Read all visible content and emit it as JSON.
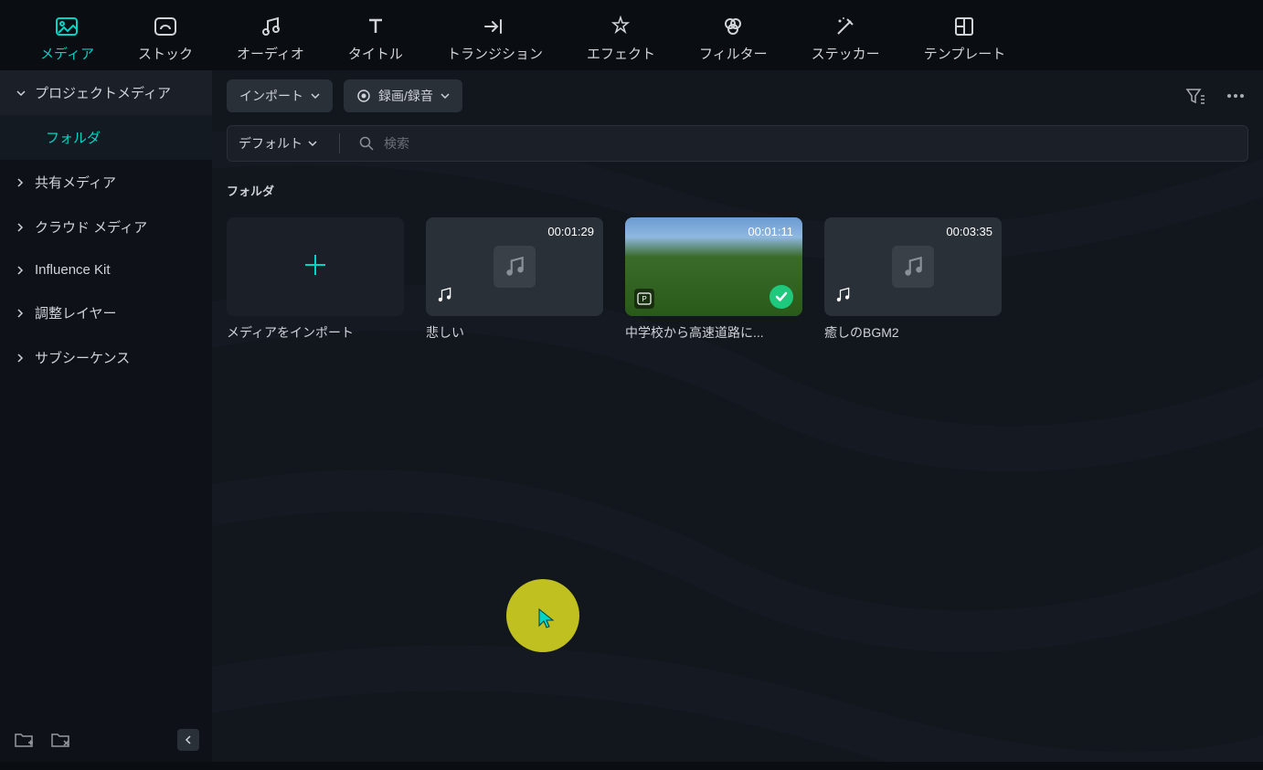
{
  "top_tabs": {
    "media": "メディア",
    "stock": "ストック",
    "audio": "オーディオ",
    "title": "タイトル",
    "transition": "トランジション",
    "effect": "エフェクト",
    "filter": "フィルター",
    "sticker": "ステッカー",
    "template": "テンプレート"
  },
  "sidebar": {
    "project_media": "プロジェクトメディア",
    "folder": "フォルダ",
    "shared_media": "共有メディア",
    "cloud_media": "クラウド メディア",
    "influence_kit": "Influence Kit",
    "adjustment_layer": "調整レイヤー",
    "subsequence": "サブシーケンス"
  },
  "toolbar": {
    "import": "インポート",
    "record": "録画/録音"
  },
  "search": {
    "sort": "デフォルト",
    "placeholder": "検索"
  },
  "section": {
    "folder": "フォルダ"
  },
  "media": {
    "import_label": "メディアをインポート",
    "items": [
      {
        "duration": "00:01:29",
        "label": "悲しい",
        "type": "audio"
      },
      {
        "duration": "00:01:11",
        "label": "中学校から高速道路に...",
        "type": "video"
      },
      {
        "duration": "00:03:35",
        "label": "癒しのBGM2",
        "type": "audio"
      }
    ]
  }
}
